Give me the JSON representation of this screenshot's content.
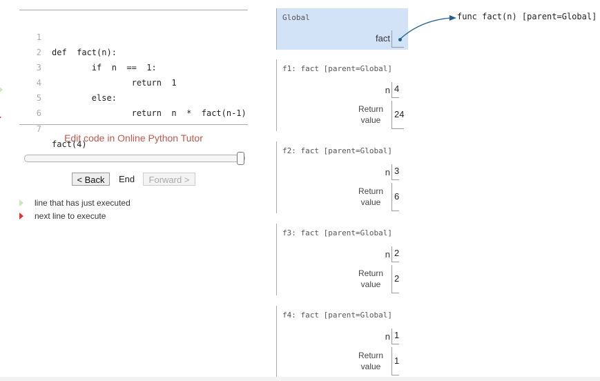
{
  "code": {
    "lines": [
      {
        "num": "1",
        "text": "def  fact(n):"
      },
      {
        "num": "2",
        "text": "        if  n  ==  1:"
      },
      {
        "num": "3",
        "text": "                return  1"
      },
      {
        "num": "4",
        "text": "        else:"
      },
      {
        "num": "5",
        "text": "                return  n  *  fact(n-1)"
      },
      {
        "num": "6",
        "text": ""
      },
      {
        "num": "7",
        "text": "fact(4)"
      }
    ]
  },
  "edit_link": "Edit code in Online Python Tutor",
  "controls": {
    "back_label": "< Back",
    "step_label": "End",
    "forward_label": "Forward >",
    "slider_position": 1.0
  },
  "legend": {
    "executed": "line that has just executed",
    "next": "next line to execute"
  },
  "global_frame": {
    "title": "Global",
    "var_name": "fact"
  },
  "frames": [
    {
      "title": "f1: fact [parent=Global]",
      "var": "n",
      "n_value": "4",
      "return_label_1": "Return",
      "return_label_2": "value",
      "return_value": "24"
    },
    {
      "title": "f2: fact [parent=Global]",
      "var": "n",
      "n_value": "3",
      "return_label_1": "Return",
      "return_label_2": "value",
      "return_value": "6"
    },
    {
      "title": "f3: fact [parent=Global]",
      "var": "n",
      "n_value": "2",
      "return_label_1": "Return",
      "return_label_2": "value",
      "return_value": "2"
    },
    {
      "title": "f4: fact [parent=Global]",
      "var": "n",
      "n_value": "1",
      "return_label_1": "Return",
      "return_label_2": "value",
      "return_value": "1"
    }
  ],
  "heap": {
    "func_label": "func fact(n) [parent=Global]"
  },
  "colors": {
    "global_bg": "#d2e2f7",
    "arrow": "#1f5f91",
    "link": "#c0564b",
    "executed_arrow": "#c8e6c0",
    "next_arrow": "#e33333"
  }
}
